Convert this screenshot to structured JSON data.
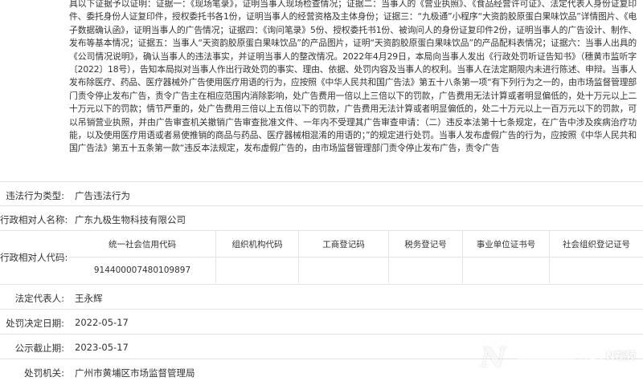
{
  "case_facts": "具以下证据予以证明：证据一：《现场笔录》，证明当事人现场检查情况；证据二：当事人的《营业执照》、《食品经营许可证》、法定代表人身份证复印件、委托身份人证复印件，授权委托书各1份，证明当事人的经营资格及主体身份；证据三：“九极通”小程序“大资韵胶原蛋白果味饮品”详情图片、《电子数据确认函》，证明当事人的广告情况；证据四：《询问笔录》5份、授权委托书1份、被询问人的身份证复印件2份，证明当事人的广告设计、制作、发布等基本情况；证据五：当事人“天资韵胶原蛋白果味饮品”的产品图片，证明“天资韵胶原蛋白果味饮品”的产品配料表情况；证据六：当事人出具的《公司情况说明》，确认当事人的违法事实，并证明当事人的整改情况。2022年4月29日，本局向当事人发出《行政处罚听证告知书》（穗黄市监听字〔2022〕18号），告知本局拟对当事人作出行政处罚的事实、理由、依据、处罚内容及当事人的权利。当事人在法定期限内未进行陈述、申辩。当事人发布除医疗、药品、医疗器械外广告使用医疗用语的行为，应按照《中华人民共和国广告法》第五十八条第一项“有下列行为之一的，由市场监督管理部门责令停止发布广告，责令广告主在相应范围内消除影响，处广告费用一倍以上三倍以下的罚款，广告费用无法计算或者明显偏低的，处十万元以上二十万元以下的罚款；情节严重的，处广告费用三倍以上五倍以下的罚款，广告费用无法计算或者明显偏低的，处二十万元以上一百万元以下的罚款，可以吊销营业执照，并由广告审查机关撤销广告审查批准文件、一年内不受理其广告审查申请：（二）违反本法第十七条规定，在广告中涉及疾病治疗功能，以及使用医疗用语或者易使推销的商品与药品、医疗器械相混淆的用语的；”的规定进行处罚。当事人发布虚假广告的行为，应按照《中华人民共和国广告法》第五十五条第一款“违反本法规定，发布虚假广告的，由市场监督管理部门责令停止发布广告，责令广告",
  "fields": {
    "violation_type": {
      "label": "违法行为类型:",
      "value": "广告违法行为"
    },
    "counterparty": {
      "label": "行政相对人名称:",
      "value": "广东九极生物科技有限公司"
    },
    "codes": {
      "label": "行政相对人代码:",
      "headers": [
        "统一社会信用代码",
        "组织机构代码",
        "工商登记码",
        "税务登记号",
        "事业单位证书号",
        "社会组织登记证号"
      ],
      "values": [
        "914400007480109897",
        "",
        "",
        "",
        "",
        ""
      ]
    },
    "legal_rep": {
      "label": "法定代表人:",
      "value": "王永辉"
    },
    "decision_date": {
      "label": "处罚决定日期:",
      "value": "2022-05-17"
    },
    "publicity_end": {
      "label": "公示截止期:",
      "value": "2023-05-17"
    },
    "authority": {
      "label": "处罚机关:",
      "value": "广州市黄埔区市场监督管理局"
    }
  },
  "watermark": {
    "main": "N",
    "sub": "N视频"
  }
}
